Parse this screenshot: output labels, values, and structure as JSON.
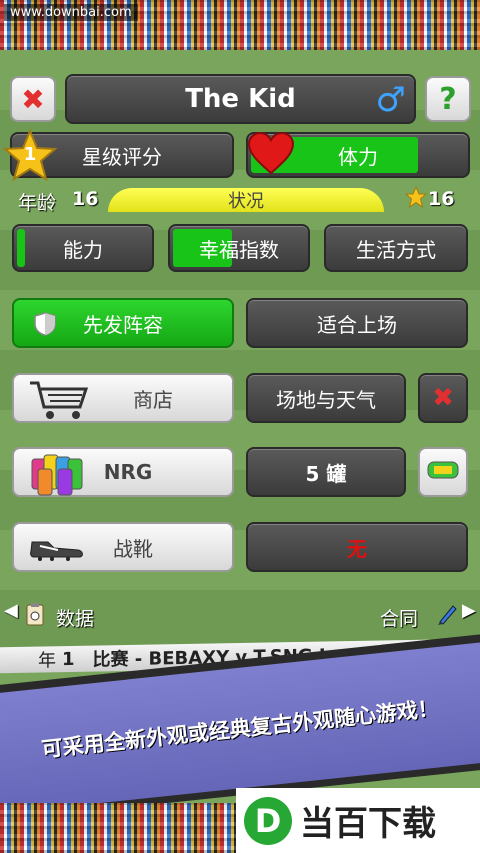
{
  "watermark": {
    "url": "www.downbai.com"
  },
  "header": {
    "close_icon": "close-x-icon",
    "player_name": "The Kid",
    "gender_icon": "male-symbol-icon",
    "help_label": "?"
  },
  "ratings": {
    "star_rank": "1",
    "star_label": "星级评分",
    "stamina_label": "体力",
    "stamina_level": 0.78
  },
  "info": {
    "age_label": "年龄",
    "age_value": "16",
    "status_label": "状况",
    "star_count": "16"
  },
  "attributes": [
    {
      "label": "能力",
      "level": 0.06
    },
    {
      "label": "幸福指数",
      "level": 0.45
    },
    {
      "label": "生活方式",
      "level": 0
    }
  ],
  "lineup": {
    "starting_label": "先发阵容",
    "fit_label": "适合上场"
  },
  "shop": {
    "shop_label": "商店",
    "pitch_weather_label": "场地与天气"
  },
  "nrg": {
    "label": "NRG",
    "count_label": "5 罐"
  },
  "boots": {
    "label": "战靴",
    "value": "无"
  },
  "nav": {
    "left_label": "数据",
    "right_label": "合同"
  },
  "ticker": {
    "year_label": "年",
    "year_value": "1",
    "match_text": "比赛 - BEBAXY v T.SNG L"
  },
  "promo": {
    "text": "可采用全新外观或经典复古外观随心游戏！"
  },
  "logo": {
    "letter": "D",
    "text": "当百下载"
  },
  "colors": {
    "accent_green": "#18c418",
    "status_yellow": "#f0f02a",
    "close_red": "#e23030",
    "boots_none_red": "#e01010"
  }
}
